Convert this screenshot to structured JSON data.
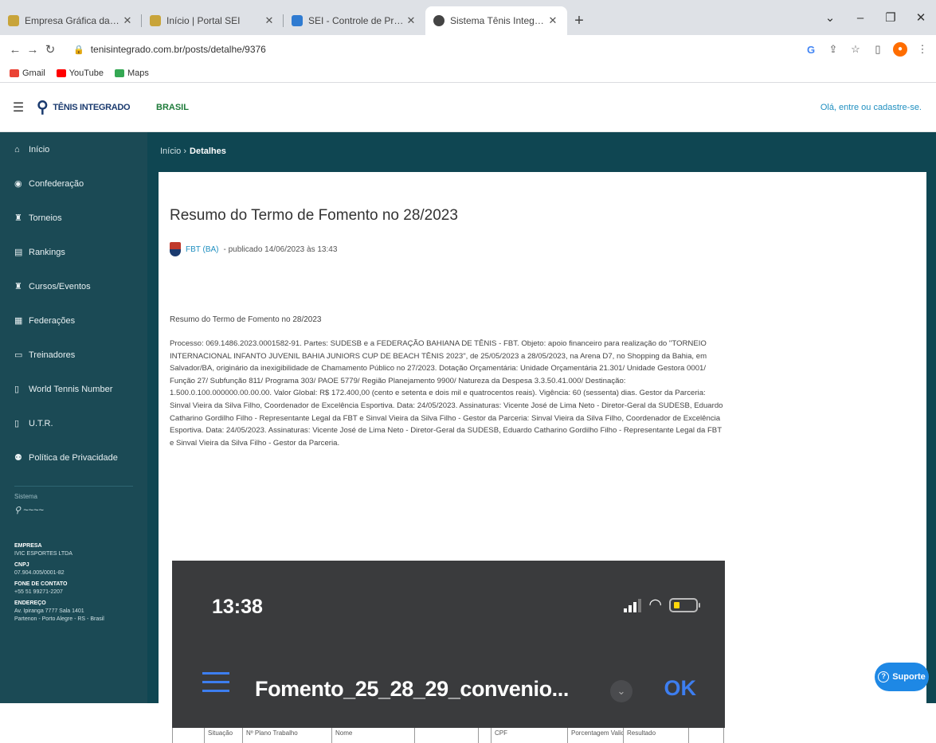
{
  "browser": {
    "tabs": [
      {
        "title": "Empresa Gráfica da Bahia - EGB - I",
        "favicon_color": "#c8a43a"
      },
      {
        "title": "Início | Portal SEI",
        "favicon_color": "#c8a43a"
      },
      {
        "title": "SEI - Controle de Processos",
        "favicon_color": "#2f7bd1"
      },
      {
        "title": "Sistema Tênis Integrado",
        "favicon_color": "#444444"
      }
    ],
    "url": "tenisintegrado.com.br/posts/detalhe/9376",
    "bookmarks": [
      {
        "label": "Gmail",
        "color": "#ea4335"
      },
      {
        "label": "YouTube",
        "color": "#ff0000"
      },
      {
        "label": "Maps",
        "color": "#34a853"
      }
    ]
  },
  "site": {
    "logo_text": "TÊNIS INTEGRADO",
    "country": "BRASIL",
    "login_msg": "Olá, entre ou cadastre-se."
  },
  "sidebar": {
    "items": [
      {
        "label": "Início",
        "icon": "home-icon"
      },
      {
        "label": "Confederação",
        "icon": "location-icon"
      },
      {
        "label": "Torneios",
        "icon": "trophy-icon"
      },
      {
        "label": "Rankings",
        "icon": "list-icon"
      },
      {
        "label": "Cursos/Eventos",
        "icon": "trophy-icon"
      },
      {
        "label": "Federações",
        "icon": "building-icon"
      },
      {
        "label": "Treinadores",
        "icon": "card-icon"
      },
      {
        "label": "World Tennis Number",
        "icon": "document-icon"
      },
      {
        "label": "U.T.R.",
        "icon": "document-icon"
      },
      {
        "label": "Política de Privacidade",
        "icon": "users-icon"
      }
    ],
    "brand_small": "Sistema",
    "company": {
      "empresa_label": "EMPRESA",
      "empresa": "IVIC ESPORTES LTDA",
      "cnpj_label": "CNPJ",
      "cnpj": "07.904.005/0001-82",
      "fone_label": "FONE DE CONTATO",
      "fone": "+55 51 99271-2207",
      "endereco_label": "ENDEREÇO",
      "endereco1": "Av. Ipiranga 7777 Sala 1401",
      "endereco2": "Partenon - Porto Alegre - RS - Brasil"
    }
  },
  "breadcrumb": {
    "home": "Início",
    "separator": "›",
    "current": "Detalhes"
  },
  "article": {
    "title": "Resumo do Termo de Fomento no 28/2023",
    "author": "FBT (BA)",
    "published": "- publicado 14/06/2023 às 13:43",
    "summary_title": "Resumo do Termo de Fomento no 28/2023",
    "body": "Processo: 069.1486.2023.0001582-91. Partes: SUDESB e a FEDERAÇÃO BAHIANA DE TÊNIS - FBT. Objeto: apoio financeiro para realização do \"TORNEIO INTERNACIONAL INFANTO JUVENIL BAHIA JUNIORS CUP DE BEACH TÊNIS 2023\", de 25/05/2023 a 28/05/2023, na Arena D7, no Shopping da Bahia, em Salvador/BA, originário da inexigibilidade de Chamamento Público no 27/2023. Dotação Orçamentária: Unidade Orçamentária 21.301/ Unidade Gestora 0001/ Função 27/ Subfunção 811/ Programa 303/ PAOE 5779/ Região Planejamento 9900/ Natureza da Despesa 3.3.50.41.000/ Destinação: 1.500.0.100.000000.00.00.00. Valor Global: R$ 172.400,00 (cento e setenta e dois mil e quatrocentos reais). Vigência: 60 (sessenta) dias. Gestor da Parceria: Sinval Vieira da Silva Filho, Coordenador de Excelência Esportiva. Data: 24/05/2023. Assinaturas: Vicente José de Lima Neto - Diretor-Geral da SUDESB, Eduardo Catharino Gordilho Filho - Representante Legal da FBT e Sinval Vieira da Silva Filho - Gestor da Parceria: Sinval Vieira da Silva Filho, Coordenador de Excelência Esportiva. Data: 24/05/2023. Assinaturas: Vicente José de Lima Neto - Diretor-Geral da SUDESB, Eduardo Catharino Gordilho Filho - Representante Legal da FBT e Sinval Vieira da Silva Filho - Gestor da Parceria."
  },
  "phone": {
    "time": "13:38",
    "filename": "Fomento_25_28_29_convenio...",
    "ok": "OK"
  },
  "table_peek": [
    "",
    "Situação",
    "Nº Plano Trabalho",
    "Nome",
    "",
    "",
    "CPF",
    "Porcentagem Validade",
    "Resultado",
    ""
  ],
  "support": {
    "label": "Suporte"
  }
}
